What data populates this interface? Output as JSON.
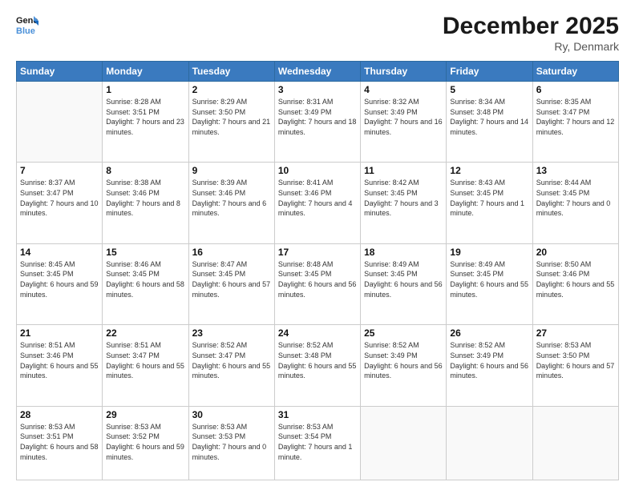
{
  "logo": {
    "line1": "General",
    "line2": "Blue"
  },
  "title": "December 2025",
  "subtitle": "Ry, Denmark",
  "days_header": [
    "Sunday",
    "Monday",
    "Tuesday",
    "Wednesday",
    "Thursday",
    "Friday",
    "Saturday"
  ],
  "weeks": [
    [
      {
        "day": "",
        "sunrise": "",
        "sunset": "",
        "daylight": ""
      },
      {
        "day": "1",
        "sunrise": "Sunrise: 8:28 AM",
        "sunset": "Sunset: 3:51 PM",
        "daylight": "Daylight: 7 hours and 23 minutes."
      },
      {
        "day": "2",
        "sunrise": "Sunrise: 8:29 AM",
        "sunset": "Sunset: 3:50 PM",
        "daylight": "Daylight: 7 hours and 21 minutes."
      },
      {
        "day": "3",
        "sunrise": "Sunrise: 8:31 AM",
        "sunset": "Sunset: 3:49 PM",
        "daylight": "Daylight: 7 hours and 18 minutes."
      },
      {
        "day": "4",
        "sunrise": "Sunrise: 8:32 AM",
        "sunset": "Sunset: 3:49 PM",
        "daylight": "Daylight: 7 hours and 16 minutes."
      },
      {
        "day": "5",
        "sunrise": "Sunrise: 8:34 AM",
        "sunset": "Sunset: 3:48 PM",
        "daylight": "Daylight: 7 hours and 14 minutes."
      },
      {
        "day": "6",
        "sunrise": "Sunrise: 8:35 AM",
        "sunset": "Sunset: 3:47 PM",
        "daylight": "Daylight: 7 hours and 12 minutes."
      }
    ],
    [
      {
        "day": "7",
        "sunrise": "Sunrise: 8:37 AM",
        "sunset": "Sunset: 3:47 PM",
        "daylight": "Daylight: 7 hours and 10 minutes."
      },
      {
        "day": "8",
        "sunrise": "Sunrise: 8:38 AM",
        "sunset": "Sunset: 3:46 PM",
        "daylight": "Daylight: 7 hours and 8 minutes."
      },
      {
        "day": "9",
        "sunrise": "Sunrise: 8:39 AM",
        "sunset": "Sunset: 3:46 PM",
        "daylight": "Daylight: 7 hours and 6 minutes."
      },
      {
        "day": "10",
        "sunrise": "Sunrise: 8:41 AM",
        "sunset": "Sunset: 3:46 PM",
        "daylight": "Daylight: 7 hours and 4 minutes."
      },
      {
        "day": "11",
        "sunrise": "Sunrise: 8:42 AM",
        "sunset": "Sunset: 3:45 PM",
        "daylight": "Daylight: 7 hours and 3 minutes."
      },
      {
        "day": "12",
        "sunrise": "Sunrise: 8:43 AM",
        "sunset": "Sunset: 3:45 PM",
        "daylight": "Daylight: 7 hours and 1 minute."
      },
      {
        "day": "13",
        "sunrise": "Sunrise: 8:44 AM",
        "sunset": "Sunset: 3:45 PM",
        "daylight": "Daylight: 7 hours and 0 minutes."
      }
    ],
    [
      {
        "day": "14",
        "sunrise": "Sunrise: 8:45 AM",
        "sunset": "Sunset: 3:45 PM",
        "daylight": "Daylight: 6 hours and 59 minutes."
      },
      {
        "day": "15",
        "sunrise": "Sunrise: 8:46 AM",
        "sunset": "Sunset: 3:45 PM",
        "daylight": "Daylight: 6 hours and 58 minutes."
      },
      {
        "day": "16",
        "sunrise": "Sunrise: 8:47 AM",
        "sunset": "Sunset: 3:45 PM",
        "daylight": "Daylight: 6 hours and 57 minutes."
      },
      {
        "day": "17",
        "sunrise": "Sunrise: 8:48 AM",
        "sunset": "Sunset: 3:45 PM",
        "daylight": "Daylight: 6 hours and 56 minutes."
      },
      {
        "day": "18",
        "sunrise": "Sunrise: 8:49 AM",
        "sunset": "Sunset: 3:45 PM",
        "daylight": "Daylight: 6 hours and 56 minutes."
      },
      {
        "day": "19",
        "sunrise": "Sunrise: 8:49 AM",
        "sunset": "Sunset: 3:45 PM",
        "daylight": "Daylight: 6 hours and 55 minutes."
      },
      {
        "day": "20",
        "sunrise": "Sunrise: 8:50 AM",
        "sunset": "Sunset: 3:46 PM",
        "daylight": "Daylight: 6 hours and 55 minutes."
      }
    ],
    [
      {
        "day": "21",
        "sunrise": "Sunrise: 8:51 AM",
        "sunset": "Sunset: 3:46 PM",
        "daylight": "Daylight: 6 hours and 55 minutes."
      },
      {
        "day": "22",
        "sunrise": "Sunrise: 8:51 AM",
        "sunset": "Sunset: 3:47 PM",
        "daylight": "Daylight: 6 hours and 55 minutes."
      },
      {
        "day": "23",
        "sunrise": "Sunrise: 8:52 AM",
        "sunset": "Sunset: 3:47 PM",
        "daylight": "Daylight: 6 hours and 55 minutes."
      },
      {
        "day": "24",
        "sunrise": "Sunrise: 8:52 AM",
        "sunset": "Sunset: 3:48 PM",
        "daylight": "Daylight: 6 hours and 55 minutes."
      },
      {
        "day": "25",
        "sunrise": "Sunrise: 8:52 AM",
        "sunset": "Sunset: 3:49 PM",
        "daylight": "Daylight: 6 hours and 56 minutes."
      },
      {
        "day": "26",
        "sunrise": "Sunrise: 8:52 AM",
        "sunset": "Sunset: 3:49 PM",
        "daylight": "Daylight: 6 hours and 56 minutes."
      },
      {
        "day": "27",
        "sunrise": "Sunrise: 8:53 AM",
        "sunset": "Sunset: 3:50 PM",
        "daylight": "Daylight: 6 hours and 57 minutes."
      }
    ],
    [
      {
        "day": "28",
        "sunrise": "Sunrise: 8:53 AM",
        "sunset": "Sunset: 3:51 PM",
        "daylight": "Daylight: 6 hours and 58 minutes."
      },
      {
        "day": "29",
        "sunrise": "Sunrise: 8:53 AM",
        "sunset": "Sunset: 3:52 PM",
        "daylight": "Daylight: 6 hours and 59 minutes."
      },
      {
        "day": "30",
        "sunrise": "Sunrise: 8:53 AM",
        "sunset": "Sunset: 3:53 PM",
        "daylight": "Daylight: 7 hours and 0 minutes."
      },
      {
        "day": "31",
        "sunrise": "Sunrise: 8:53 AM",
        "sunset": "Sunset: 3:54 PM",
        "daylight": "Daylight: 7 hours and 1 minute."
      },
      {
        "day": "",
        "sunrise": "",
        "sunset": "",
        "daylight": ""
      },
      {
        "day": "",
        "sunrise": "",
        "sunset": "",
        "daylight": ""
      },
      {
        "day": "",
        "sunrise": "",
        "sunset": "",
        "daylight": ""
      }
    ]
  ]
}
